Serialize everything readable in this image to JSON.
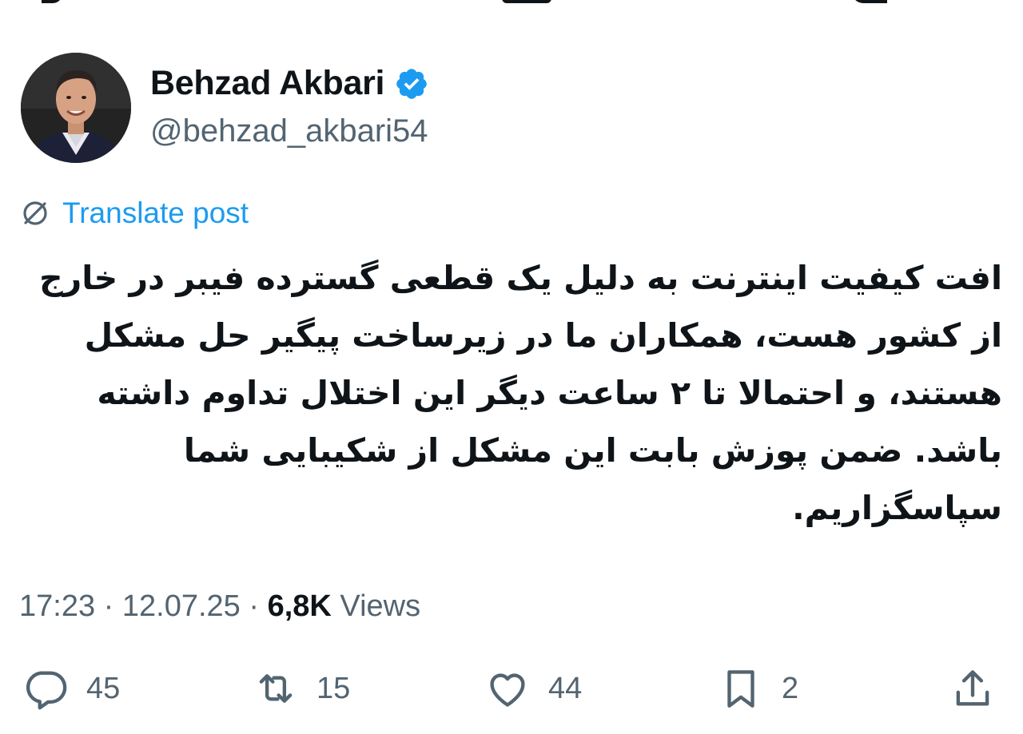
{
  "author": {
    "display_name": "Behzad Akbari",
    "handle": "@behzad_akbari54",
    "verified": true,
    "verified_color": "#1d9bf0"
  },
  "translate": {
    "label": "Translate post",
    "icon": "translate-icon"
  },
  "post": {
    "text": "افت کیفیت اینترنت به دلیل یک قطعی گسترده فیبر در خارج از کشور هست، همکاران ما در زیرساخت پیگیر حل مشکل هستند، و احتمالا تا ۲ ساعت دیگر این اختلال تداوم داشته باشد. ضمن پوزش بابت این مشکل از شکیبایی شما سپاسگزاریم."
  },
  "meta": {
    "time": "17:23",
    "sep1": "·",
    "date": "12.07.25",
    "sep2": "·",
    "views_count": "6,8K",
    "views_label": "Views"
  },
  "actions": {
    "replies": "45",
    "reposts": "15",
    "likes": "44",
    "bookmarks": "2"
  },
  "colors": {
    "text": "#0f1419",
    "secondary": "#536471",
    "accent": "#1d9bf0"
  }
}
